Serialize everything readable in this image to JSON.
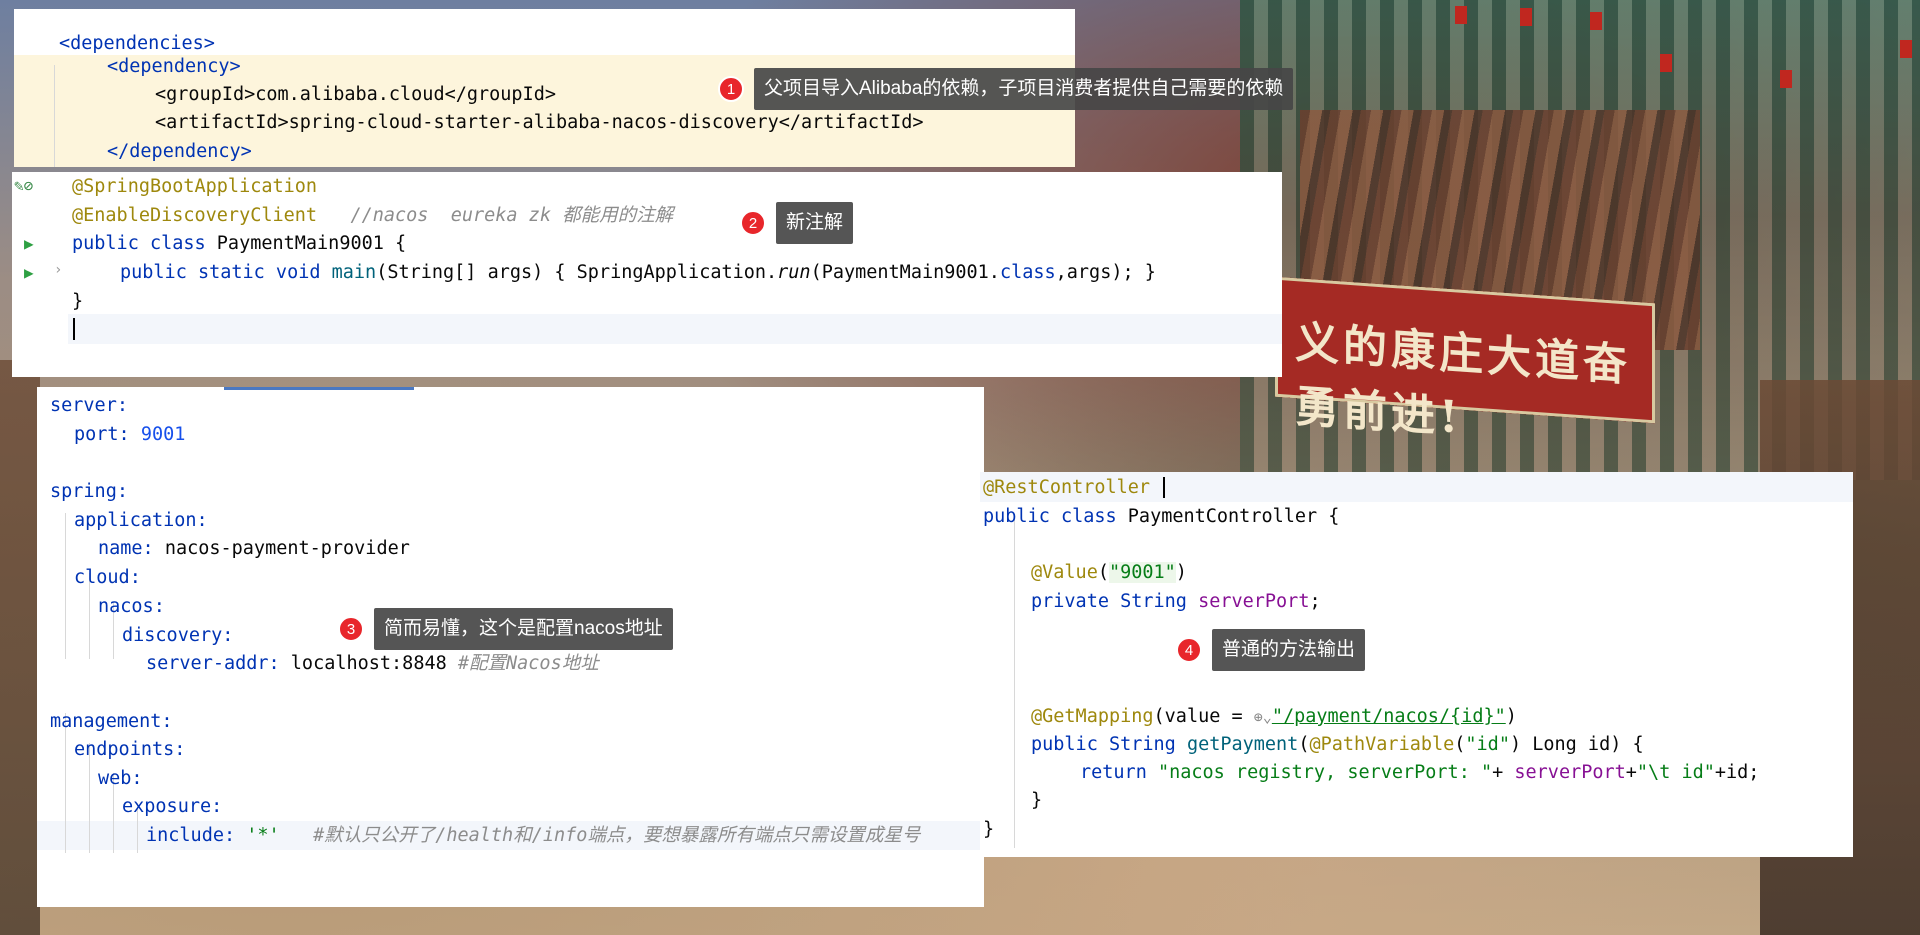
{
  "panel1": {
    "lines": [
      "<dependencies>",
      "<dependency>",
      "<groupId>com.alibaba.cloud</groupId>",
      "<artifactId>spring-cloud-starter-alibaba-nacos-discovery</artifactId>",
      "</dependency>"
    ],
    "callout": {
      "number": "1",
      "text": "父项目导入Alibaba的依赖，子项目消费者提供自己需要的依赖"
    }
  },
  "panel2": {
    "ann1": "@SpringBootApplication",
    "ann2": "@EnableDiscoveryClient",
    "comment": "//nacos  eureka zk 都能用的注解",
    "class_decl_kw": "public class ",
    "class_name": "PaymentMain9001 {",
    "main_kw": "public static void ",
    "main_fn": "main",
    "main_params": "(String[] args) { SpringApplication.",
    "run_fn": "run",
    "run_args_pre": "(PaymentMain9001.",
    "run_class_kw": "class",
    "run_args_post": ",args); }",
    "close_brace": "}",
    "callout": {
      "number": "2",
      "text": "新注解"
    }
  },
  "panel3": {
    "server": "server:",
    "port_key": "port: ",
    "port_val": "9001",
    "spring": "spring:",
    "application": "application:",
    "name_key": "name: ",
    "name_val": "nacos-payment-provider",
    "cloud": "cloud:",
    "nacos": "nacos:",
    "discovery": "discovery:",
    "server_addr_key": "server-addr: ",
    "server_addr_val": "localhost:8848",
    "server_addr_comment": "#配置Nacos地址",
    "management": "management:",
    "endpoints": "endpoints:",
    "web": "web:",
    "exposure": "exposure:",
    "include_key": "include: ",
    "include_val": "'*'",
    "include_comment": "#默认只公开了/health和/info端点，要想暴露所有端点只需设置成星号",
    "callout": {
      "number": "3",
      "text": "简而易懂，这个是配置nacos地址"
    }
  },
  "panel4": {
    "ann_rest": "@RestController",
    "class_kw": "public class ",
    "class_name": "PaymentController {",
    "value_ann": "@Value",
    "value_arg": "\"9001\"",
    "field_kw": "private String ",
    "field_name": "serverPort",
    "get_ann": "@GetMapping",
    "get_pre": "(value = ",
    "get_path": "\"/payment/nacos/{id}\"",
    "get_post": ")",
    "method_kw": "public String ",
    "method_name": "getPayment",
    "pathvar_ann": "@PathVariable",
    "pathvar_arg": "\"id\"",
    "method_post": " Long id) {",
    "return_kw": "return ",
    "return_str1": "\"nacos registry, serverPort: \"",
    "return_mid": "+ ",
    "return_field": "serverPort",
    "return_plus": "+",
    "return_str2": "\"\\t id\"",
    "return_end": "+id;",
    "close_inner": "}",
    "close_outer": "}",
    "callout": {
      "number": "4",
      "text": "普通的方法输出"
    }
  },
  "background": {
    "banner_text": "义的康庄大道奋勇前进!"
  }
}
